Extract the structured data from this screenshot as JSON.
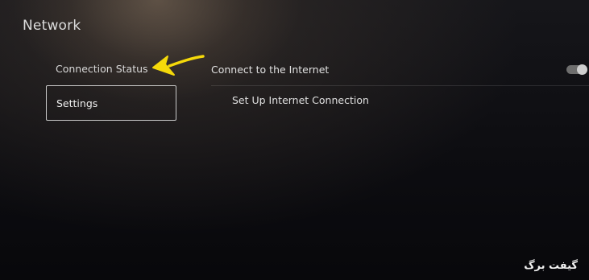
{
  "page": {
    "title": "Network"
  },
  "menu": {
    "items": [
      {
        "label": "Connection Status"
      },
      {
        "label": "Settings",
        "selected": true
      }
    ]
  },
  "settings": {
    "connect_label": "Connect to the Internet",
    "connect_enabled": true,
    "setup_label": "Set Up Internet Connection"
  },
  "annotation": {
    "arrow_color": "#f5d90a",
    "icon": "arrow-pointer-icon"
  },
  "watermark": {
    "text": "گیفت برگ"
  }
}
